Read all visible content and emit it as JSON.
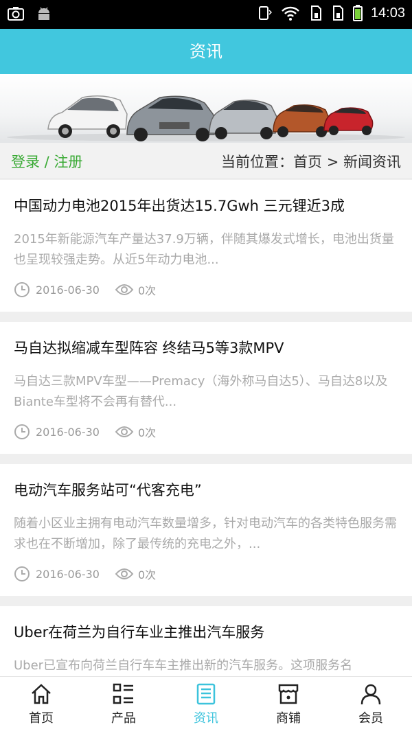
{
  "status": {
    "time": "14:03"
  },
  "header": {
    "title": "资讯"
  },
  "crumbbar": {
    "login": "登录 / 注册",
    "location": "当前位置：首页 > 新闻资讯"
  },
  "articles": [
    {
      "title": "中国动力电池2015年出货达15.7Gwh 三元锂近3成",
      "desc": "2015年新能源汽车产量达37.9万辆，伴随其爆发式增长，电池出货量也呈现较强走势。从近5年动力电池...",
      "date": "2016-06-30",
      "views": "0次"
    },
    {
      "title": "马自达拟缩减车型阵容 终结马5等3款MPV",
      "desc": "马自达三款MPV车型——Premacy（海外称马自达5）、马自达8以及Biante车型将不会再有替代...",
      "date": "2016-06-30",
      "views": "0次"
    },
    {
      "title": "电动汽车服务站可“代客充电”",
      "desc": "随着小区业主拥有电动汽车数量增多，针对电动汽车的各类特色服务需求也在不断增加，除了最传统的充电之外，...",
      "date": "2016-06-30",
      "views": "0次"
    },
    {
      "title": "Uber在荷兰为自行车业主推出汽车服务",
      "desc": "Uber已宣布向荷兰自行车车主推出新的汽车服务。这项服务名",
      "date": "",
      "views": ""
    }
  ],
  "tabs": [
    {
      "label": "首页",
      "icon": "home-icon"
    },
    {
      "label": "产品",
      "icon": "grid-list-icon"
    },
    {
      "label": "资讯",
      "icon": "document-icon"
    },
    {
      "label": "商铺",
      "icon": "store-icon"
    },
    {
      "label": "会员",
      "icon": "user-icon"
    }
  ],
  "colors": {
    "accent": "#41c7de",
    "login": "#3aaa35",
    "tab_active": "#3cc3dc"
  }
}
